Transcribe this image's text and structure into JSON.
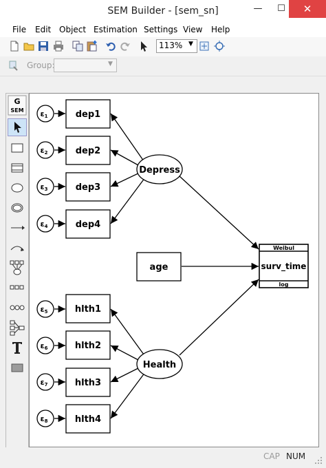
{
  "window": {
    "title": "SEM Builder - [sem_sn]",
    "minimize_glyph": "—",
    "maximize_glyph": "☐",
    "close_glyph": "✕"
  },
  "menu": [
    "File",
    "Edit",
    "Object",
    "Estimation",
    "Settings",
    "View",
    "Help"
  ],
  "toolbar": {
    "zoom": "113%",
    "icons": [
      "new-icon",
      "open-icon",
      "save-icon",
      "print-icon",
      "copy-icon",
      "paste-icon",
      "undo-icon",
      "redo-icon",
      "select-icon",
      "fit-icon",
      "zoom-region-icon"
    ]
  },
  "groupbar": {
    "label": "Group:",
    "value": ""
  },
  "palette": {
    "logo_top": "G",
    "logo_bottom": "SEM",
    "tools": [
      "select-tool",
      "observed-variable-tool",
      "generalized-observed-tool",
      "latent-variable-tool",
      "multilevel-latent-tool",
      "path-tool",
      "covariance-tool",
      "measurement-component-tool",
      "regression-component-tool",
      "latent-regression-tool",
      "multilevel-tool",
      "text-tool",
      "area-tool"
    ]
  },
  "diagram": {
    "errors": [
      {
        "symbol": "ε",
        "sub": "1"
      },
      {
        "symbol": "ε",
        "sub": "2"
      },
      {
        "symbol": "ε",
        "sub": "3"
      },
      {
        "symbol": "ε",
        "sub": "4"
      },
      {
        "symbol": "ε",
        "sub": "5"
      },
      {
        "symbol": "ε",
        "sub": "6"
      },
      {
        "symbol": "ε",
        "sub": "7"
      },
      {
        "symbol": "ε",
        "sub": "8"
      }
    ],
    "observed": [
      "dep1",
      "dep2",
      "dep3",
      "dep4",
      "hlth1",
      "hlth2",
      "hlth3",
      "hlth4"
    ],
    "latent": [
      "Depress",
      "Health"
    ],
    "covariate": "age",
    "outcome": {
      "name": "surv_time",
      "family": "Weibul",
      "link": "log"
    }
  },
  "status": {
    "cap": "CAP",
    "num": "NUM"
  }
}
